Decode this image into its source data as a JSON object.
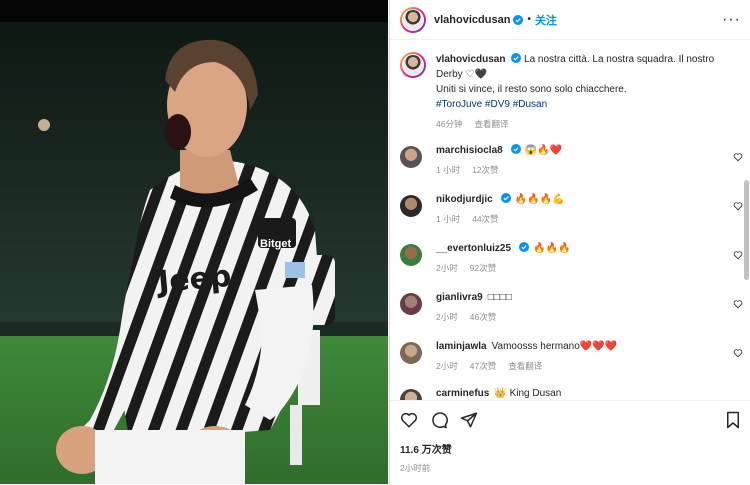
{
  "post": {
    "username": "vlahovicdusan",
    "follow_label": "关注",
    "caption_line1": "La nostra città. La nostra squadra. Il nostro Derby",
    "caption_line2": "Uniti si vince, il resto sono solo chiacchere.",
    "hashtags": "#ToroJuve #DV9 #Dusan",
    "caption_time": "46分钟",
    "see_translation": "查看翻译",
    "likes": "11.6 万次赞",
    "posted": "2小时前",
    "jersey_sponsor": "Jeep",
    "jersey_brand": "Bitget"
  },
  "comments": [
    {
      "user": "marchisiocla8",
      "text": "😱🔥❤️",
      "time": "1 小时",
      "likes": "12次赞",
      "reply": ""
    },
    {
      "user": "nikodjurdjic",
      "text": "🔥🔥🔥💪",
      "time": "1 小时",
      "likes": "44次赞",
      "reply": ""
    },
    {
      "user": "__evertonluiz25",
      "text": "🔥🔥🔥",
      "time": "2小时",
      "likes": "92次赞",
      "reply": ""
    },
    {
      "user": "gianlivra9",
      "text": "□□□□",
      "time": "2小时",
      "likes": "46次赞",
      "reply": ""
    },
    {
      "user": "laminjawla",
      "text": "Vamoosss hermano❤️❤️❤️",
      "time": "2小时",
      "likes": "47次赞",
      "reply": "查看翻译"
    },
    {
      "user": "carminefus",
      "text": "👑 King Dusan",
      "time": "",
      "likes": "",
      "reply": ""
    }
  ],
  "colors": {
    "accent": "#0095f6",
    "hashtag": "#00376b",
    "muted": "#8e8e8e"
  },
  "icons": [
    "verified-icon",
    "more-icon",
    "heart-icon",
    "comment-icon",
    "share-icon",
    "bookmark-icon"
  ]
}
